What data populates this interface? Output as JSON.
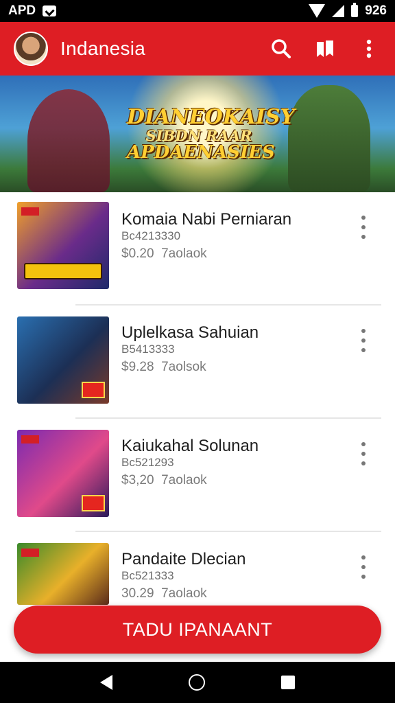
{
  "status_bar": {
    "left_text": "APD",
    "time": "926"
  },
  "app_bar": {
    "title": "Indanesia"
  },
  "banner": {
    "title_lines": [
      "DIANEOKAISY",
      "SIBDN RAAR",
      "APDAENASIES"
    ],
    "carousel_count": 3,
    "carousel_active": 2
  },
  "items": [
    {
      "title": "Komaia Nabi Perniaran",
      "subtitle": "Bc4213330",
      "price": "$0.20",
      "meta": "7aolaok",
      "thumb_colors": [
        "#f0a02a",
        "#6a2b8a",
        "#1e2a6a"
      ]
    },
    {
      "title": "Uplelkasa Sahuian",
      "subtitle": "B5413333",
      "price": "$9.28",
      "meta": "7aolsok",
      "thumb_colors": [
        "#2a6fb0",
        "#1c2f55",
        "#7a3a2a"
      ]
    },
    {
      "title": "Kaiukahal Solunan",
      "subtitle": "Bc521293",
      "price": "$3,20",
      "meta": "7aolaok",
      "thumb_colors": [
        "#7a2ab0",
        "#e04a8a",
        "#2a1a5a"
      ]
    },
    {
      "title": "Pandaite Dlecian",
      "subtitle": "Bc521333",
      "price": "30.29",
      "meta": "7aolaok",
      "thumb_colors": [
        "#3a8a2a",
        "#e8b02a",
        "#5a2a1a"
      ]
    }
  ],
  "cta": {
    "label": "TADU IPANAANT"
  },
  "colors": {
    "brand_red": "#de1e24",
    "text_dark": "#1f1f1f",
    "text_muted": "#6e6e6e"
  },
  "icons": {
    "search": "search-icon",
    "bookmarks": "bookmarks-icon",
    "more": "more-vert-icon",
    "back": "nav-back-icon",
    "home": "nav-home-icon",
    "recents": "nav-recents-icon"
  }
}
